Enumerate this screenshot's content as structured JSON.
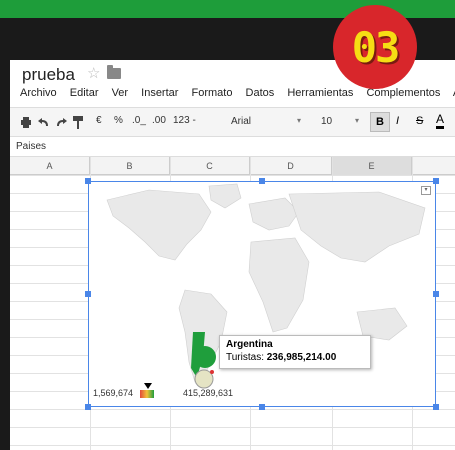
{
  "badge": {
    "number": "03"
  },
  "sheet": {
    "title": "prueba",
    "menu": [
      "Archivo",
      "Editar",
      "Ver",
      "Insertar",
      "Formato",
      "Datos",
      "Herramientas",
      "Complementos",
      "Ay"
    ],
    "toolbar": {
      "currency": "€",
      "percent": "%",
      "decimal_less": ".0_",
      "decimal_more": ".00",
      "number_format": "123 -",
      "font": "Arial",
      "font_size": "10",
      "bold": "B",
      "italic": "I",
      "strike": "S",
      "text_color": "A"
    },
    "formula_bar_value": "Paises",
    "columns": [
      "A",
      "B",
      "C",
      "D",
      "E"
    ]
  },
  "chart_data": {
    "type": "geo",
    "region": "world",
    "highlighted": {
      "name": "Argentina",
      "label": "Turistas:",
      "value": "236,985,214.00"
    },
    "legend": {
      "min": "1,569,674",
      "max": "415,289,631"
    }
  }
}
